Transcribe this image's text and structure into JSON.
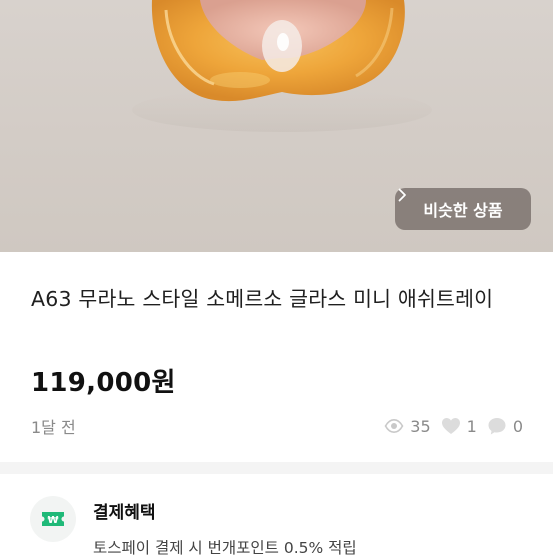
{
  "product": {
    "image_alt": "glass ashtray photo",
    "similar_button_label": "비슷한 상품",
    "title": "A63 무라노 스타일 소메르소 글라스 미니 애쉬트레이",
    "price": "119,000원",
    "posted_time": "1달 전",
    "stats": {
      "views": "35",
      "likes": "1",
      "chats": "0"
    }
  },
  "benefits": {
    "title": "결제혜택",
    "description": "토스페이 결제 시 번개포인트 0.5% 적립",
    "icon": "won-ticket-icon",
    "icon_color": "#1fb978"
  },
  "colors": {
    "divider": "#f4f4f4",
    "muted_text": "#8a8a8a"
  }
}
